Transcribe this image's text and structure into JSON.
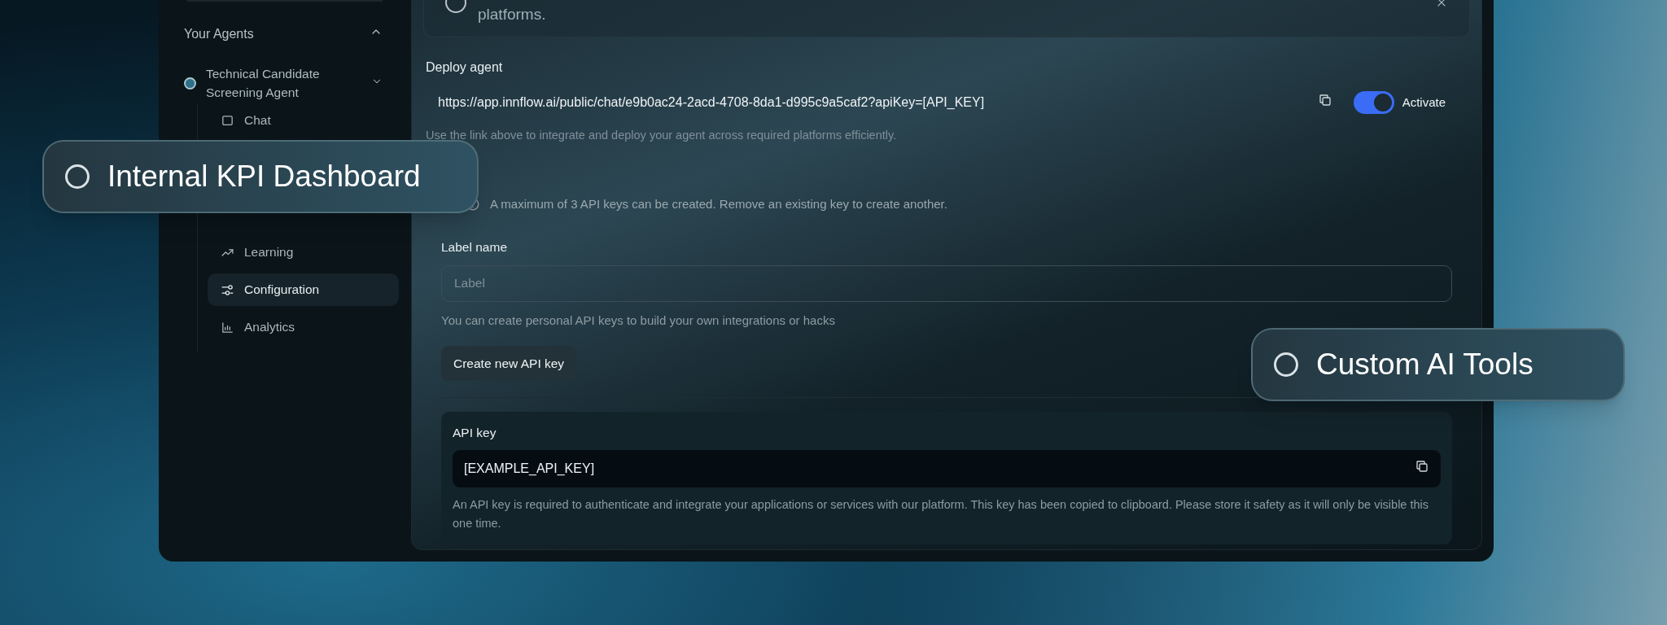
{
  "sidebar": {
    "section": {
      "title": "Your Agents",
      "expanded": true
    },
    "agent": {
      "name": "Technical Candidate Screening Agent",
      "expanded": false
    },
    "items": [
      {
        "label": "Chat",
        "kind": "chat",
        "selected": false
      },
      {
        "label": "Learning",
        "kind": "trend",
        "selected": false
      },
      {
        "label": "Configuration",
        "kind": "sliders",
        "selected": true
      },
      {
        "label": "Analytics",
        "kind": "chart",
        "selected": false
      }
    ]
  },
  "top_card": {
    "text": "platforms.",
    "selected": false
  },
  "deploy": {
    "title": "Deploy agent",
    "url": "https://app.innflow.ai/public/chat/e9b0ac24-2acd-4708-8da1-d995c9a5caf2?apiKey=[API_KEY]",
    "toggle_label": "Activate",
    "on": true,
    "hint": "Use the link above to integrate and deploy your agent across required platforms efficiently."
  },
  "notice": "A maximum of 3 API keys can be created. Remove an existing key to create another.",
  "label_field": {
    "label": "Label name",
    "placeholder": "Label",
    "hint": "You can create personal API keys to build your own integrations or hacks"
  },
  "create_button": "Create new API key",
  "api_key": {
    "title": "API key",
    "value": "[EXAMPLE_API_KEY]",
    "description": "An API key is required to authenticate and integrate your applications or services with our platform. This key has been copied to clipboard. Please store it safety as it will only be visible this one time."
  },
  "overlays": [
    {
      "label": "Internal KPI Dashboard",
      "selected": false
    },
    {
      "label": "Custom AI Tools",
      "selected": false
    }
  ]
}
